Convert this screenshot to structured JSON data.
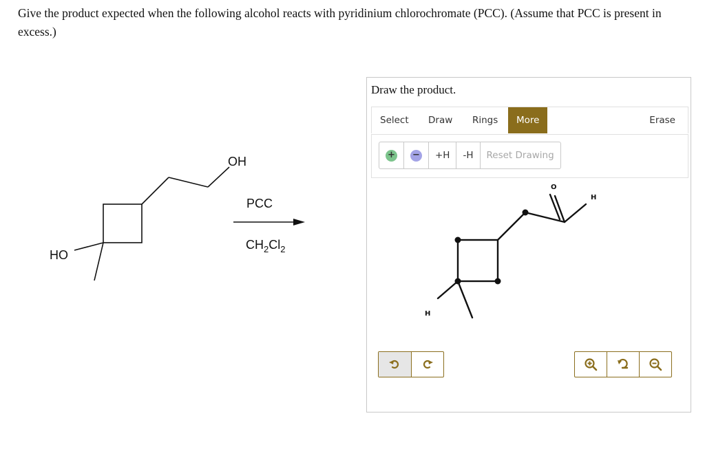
{
  "question": {
    "text": "Give the product expected when the following alcohol reacts with pyridinium chlorochromate (PCC). (Assume that PCC is present in excess.)"
  },
  "reaction": {
    "substituent_top": "OH",
    "substituent_left": "HO",
    "reagent": "PCC",
    "solvent_main": "CH",
    "solvent_sub1": "2",
    "solvent_mid": "Cl",
    "solvent_sub2": "2"
  },
  "panel": {
    "title": "Draw the product.",
    "tabs": [
      "Select",
      "Draw",
      "Rings",
      "More"
    ],
    "active_tab": "More",
    "erase_label": "Erase",
    "tools": {
      "plus_symbol": "+",
      "minus_symbol": "−",
      "add_h": "+H",
      "remove_h": "-H",
      "reset": "Reset Drawing"
    },
    "canvas_labels": {
      "oxygen": "O",
      "aldehyde_h": "H",
      "ring_h": "H"
    }
  },
  "colors": {
    "accent": "#8a6d1c",
    "plus_dot": "#7cc48c",
    "minus_dot": "#a3a3e6"
  }
}
